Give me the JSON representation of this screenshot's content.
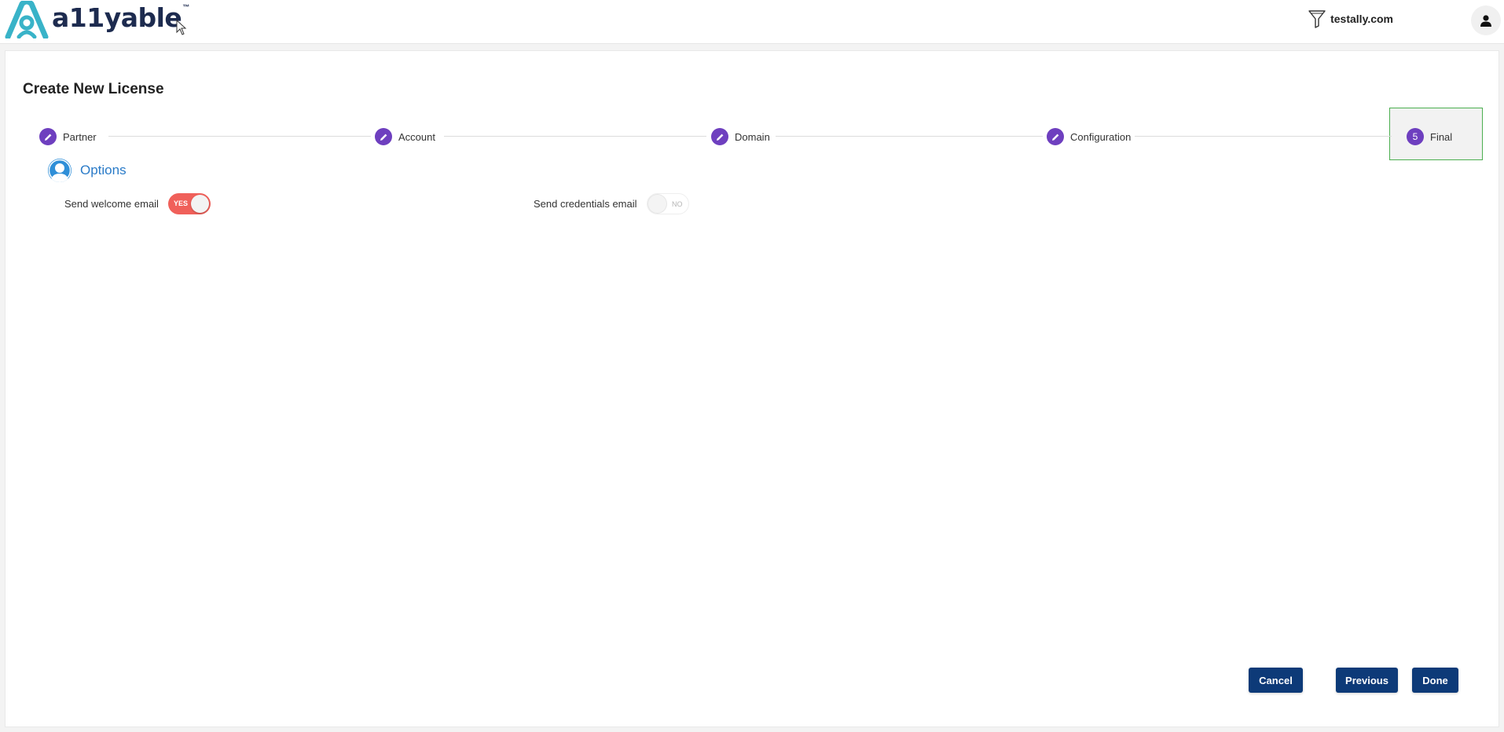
{
  "header": {
    "logo_text": "a11yable",
    "logo_tm": "™",
    "domain": "testally.com"
  },
  "page": {
    "title": "Create New License"
  },
  "stepper": {
    "steps": [
      {
        "label": "Partner",
        "status": "completed"
      },
      {
        "label": "Account",
        "status": "completed"
      },
      {
        "label": "Domain",
        "status": "completed"
      },
      {
        "label": "Configuration",
        "status": "completed"
      },
      {
        "label": "Final",
        "status": "active",
        "number": "5"
      }
    ]
  },
  "options": {
    "title": "Options",
    "welcome_email": {
      "label": "Send welcome email",
      "state": "YES"
    },
    "credentials_email": {
      "label": "Send credentials email",
      "state": "NO"
    }
  },
  "buttons": {
    "cancel": "Cancel",
    "previous": "Previous",
    "done": "Done"
  },
  "colors": {
    "accent_purple": "#6e3fbf",
    "primary_button": "#0d3a78",
    "toggle_on": "#f0605a",
    "options_blue": "#2a7bc8",
    "active_step_border": "#4caf50"
  }
}
